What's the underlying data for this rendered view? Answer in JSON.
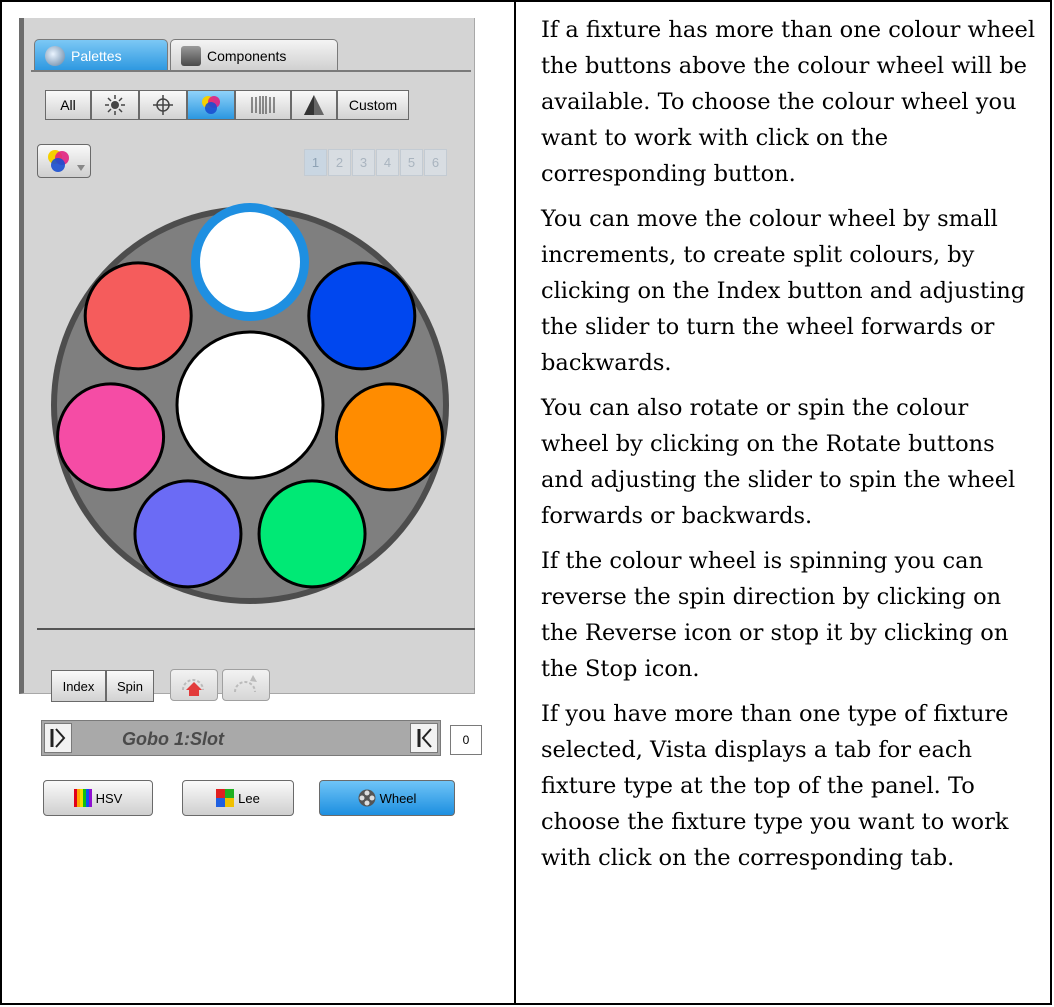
{
  "tabs": [
    {
      "label": "Palettes",
      "active": true,
      "icon": "palette-icon"
    },
    {
      "label": "Components",
      "active": false,
      "icon": "components-icon"
    }
  ],
  "filters": {
    "all_label": "All",
    "custom_label": "Custom",
    "icons": [
      "brightness-icon",
      "position-icon",
      "colour-icon",
      "beam-icon",
      "shape-icon"
    ],
    "selected": "colour-icon"
  },
  "wheel_selector": {
    "buttons": [
      "1",
      "2",
      "3",
      "4",
      "5",
      "6"
    ]
  },
  "colour_wheel": {
    "slots": [
      {
        "name": "white",
        "color": "#ffffff",
        "selected": true
      },
      {
        "name": "blue",
        "color": "#0047ef"
      },
      {
        "name": "orange",
        "color": "#ff8c00"
      },
      {
        "name": "green",
        "color": "#00e975"
      },
      {
        "name": "lavender",
        "color": "#6b6bf5"
      },
      {
        "name": "pink",
        "color": "#f54ca5"
      },
      {
        "name": "red",
        "color": "#f55c5c"
      }
    ],
    "center_color": "#ffffff",
    "selection_ring_color": "#1e8fe1"
  },
  "controls": {
    "index_label": "Index",
    "spin_label": "Spin",
    "rotate_icons": [
      "reverse-rotate-icon",
      "stop-rotate-icon"
    ]
  },
  "slider": {
    "label": "Gobo 1:Slot",
    "value": "0"
  },
  "modes": [
    {
      "label": "HSV",
      "icon": "hsv-icon",
      "selected": false
    },
    {
      "label": "Lee",
      "icon": "lee-icon",
      "selected": false
    },
    {
      "label": "Wheel",
      "icon": "wheel-icon",
      "selected": true
    }
  ],
  "paragraphs": [
    "If a fixture has more than one colour wheel the buttons above the colour wheel will be available. To choose the colour wheel you want to work with click on the corresponding button.",
    "You can move the colour wheel by small increments, to create split colours, by clicking on the Index button and adjusting the slider to turn the wheel forwards or backwards.",
    "You can also rotate or spin the colour wheel by clicking on the Rotate buttons and adjusting the slider to spin the wheel forwards or backwards.",
    "If the colour wheel is spinning you can reverse the spin direction by clicking on the Reverse icon or stop it by clicking on the Stop icon.",
    "If you have more than one type of fixture selected, Vista displays a tab for each fixture type at the top of the panel. To choose the fixture type you want to work with click on the corresponding tab."
  ]
}
